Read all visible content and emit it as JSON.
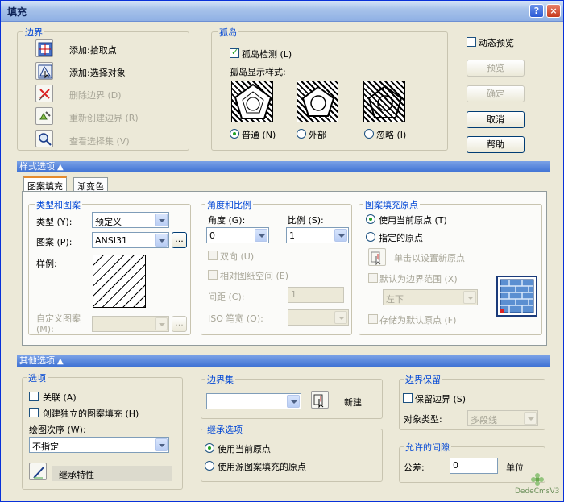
{
  "window": {
    "title": "填充",
    "help": "?",
    "close": "×"
  },
  "boundary": {
    "title": "边界",
    "add_pick": "添加:拾取点",
    "add_select": "添加:选择对象",
    "remove": "删除边界 (D)",
    "recreate": "重新创建边界 (R)",
    "view": "查看选择集 (V)"
  },
  "island": {
    "title": "孤岛",
    "detect": "孤岛检测 (L)",
    "style_label": "孤岛显示样式:",
    "normal": "普通 (N)",
    "outer": "外部",
    "ignore": "忽略 (I)"
  },
  "right_buttons": {
    "dynamic_preview": "动态预览",
    "preview": "预览",
    "ok": "确定",
    "cancel": "取消",
    "help": "帮助"
  },
  "pattern_options_bar": "样式选项",
  "tabs": {
    "hatch": "图案填充",
    "gradient": "渐变色"
  },
  "type_pattern": {
    "title": "类型和图案",
    "type_label": "类型 (Y):",
    "type_value": "预定义",
    "pattern_label": "图案 (P):",
    "pattern_value": "ANSI31",
    "pattern_browse": "...",
    "swatch_label": "样例:",
    "custom_label": "自定义图案 (M):",
    "custom_browse": "..."
  },
  "angle_scale": {
    "title": "角度和比例",
    "angle_label": "角度 (G):",
    "angle_value": "0",
    "scale_label": "比例 (S):",
    "scale_value": "1",
    "double": "双向 (U)",
    "relative": "相对图纸空间 (E)",
    "spacing_label": "间距 (C):",
    "spacing_value": "1",
    "iso_label": "ISO 笔宽 (O):"
  },
  "origin": {
    "title": "图案填充原点",
    "use_current": "使用当前原点 (T)",
    "specified": "指定的原点",
    "click_set": "单击以设置新原点",
    "default_extents": "默认为边界范围 (X)",
    "extents_value": "左下",
    "store_default": "存储为默认原点 (F)"
  },
  "other_options_bar": "其他选项",
  "options": {
    "title": "选项",
    "associative": "关联 (A)",
    "separate": "创建独立的图案填充 (H)",
    "draw_order_label": "绘图次序 (W):",
    "draw_order_value": "不指定",
    "inherit": "继承特性"
  },
  "boundary_set": {
    "title": "边界集",
    "new": "新建"
  },
  "inherit_options": {
    "title": "继承选项",
    "use_current": "使用当前原点",
    "use_source": "使用源图案填充的原点"
  },
  "retention": {
    "title": "边界保留",
    "retain": "保留边界 (S)",
    "object_type_label": "对象类型:",
    "object_type_value": "多段线"
  },
  "gap": {
    "title": "允许的间隙",
    "tolerance_label": "公差:",
    "tolerance_value": "0",
    "unit": "单位"
  },
  "watermark": "DedeCmsV3"
}
